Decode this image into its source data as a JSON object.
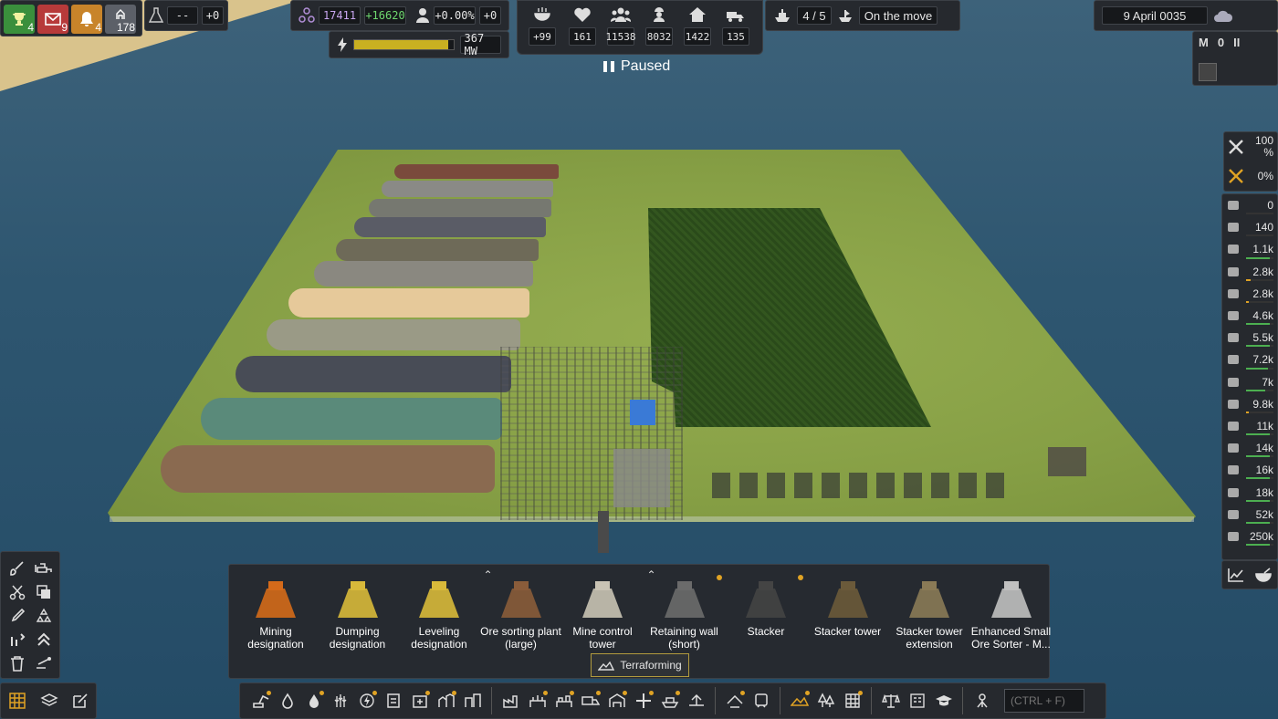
{
  "notifications": [
    {
      "icon": "trophy-icon",
      "count": "4",
      "color": "#3a8f3c"
    },
    {
      "icon": "mail-icon",
      "count": "9",
      "color": "#b73a3a"
    },
    {
      "icon": "bell-icon",
      "count": "4",
      "color": "#c8842a"
    },
    {
      "icon": "workers-icon",
      "count": "178",
      "color": "#5c6068"
    }
  ],
  "research": {
    "icon": "flask-icon",
    "value": "--",
    "delta": "+0"
  },
  "unity": {
    "value": "17411",
    "income": "+16620"
  },
  "population_growth": {
    "value": "+0.00%",
    "delta": "+0"
  },
  "power": {
    "value": "367 MW",
    "fill": 0.95
  },
  "pop_stats": [
    {
      "icon": "food-icon",
      "value": "+99"
    },
    {
      "icon": "health-icon",
      "value": "161"
    },
    {
      "icon": "population-icon",
      "value": "11538"
    },
    {
      "icon": "workers-icon",
      "value": "8032"
    },
    {
      "icon": "housing-icon",
      "value": "1422"
    },
    {
      "icon": "vehicles-icon",
      "value": "135"
    }
  ],
  "paused_label": "Paused",
  "ships": {
    "value": "4 / 5",
    "status": "On the move"
  },
  "date": "9 April 0035",
  "speed": {
    "m": "M",
    "o": "0",
    "pause": "II"
  },
  "maintenance": [
    {
      "icon": "tools-icon",
      "value": "100 %"
    },
    {
      "icon": "tools-warn-icon",
      "value": "0%"
    }
  ],
  "resources": [
    {
      "icon": "coal-icon",
      "value": "0",
      "fill": 0.0,
      "color": "#555"
    },
    {
      "icon": "flask-purple-icon",
      "value": "140",
      "fill": 0.0,
      "color": "#555"
    },
    {
      "icon": "food-crate-icon",
      "value": "1.1k",
      "fill": 0.85,
      "color": "#4caf50"
    },
    {
      "icon": "product-yellow-icon",
      "value": "2.8k",
      "fill": 0.15,
      "color": "#e0a324"
    },
    {
      "icon": "product-red-icon",
      "value": "2.8k",
      "fill": 0.1,
      "color": "#e0a324"
    },
    {
      "icon": "wood-icon",
      "value": "4.6k",
      "fill": 0.85,
      "color": "#4caf50"
    },
    {
      "icon": "plank-icon",
      "value": "5.5k",
      "fill": 0.85,
      "color": "#4caf50"
    },
    {
      "icon": "parts-icon",
      "value": "7.2k",
      "fill": 0.8,
      "color": "#4caf50"
    },
    {
      "icon": "shovel-icon",
      "value": "7k",
      "fill": 0.7,
      "color": "#4caf50"
    },
    {
      "icon": "steel-icon",
      "value": "9.8k",
      "fill": 0.1,
      "color": "#e0a324"
    },
    {
      "icon": "block-icon",
      "value": "11k",
      "fill": 0.85,
      "color": "#4caf50"
    },
    {
      "icon": "slab-icon",
      "value": "14k",
      "fill": 0.85,
      "color": "#4caf50"
    },
    {
      "icon": "barrel-icon",
      "value": "16k",
      "fill": 0.85,
      "color": "#4caf50"
    },
    {
      "icon": "fuel-icon",
      "value": "18k",
      "fill": 0.85,
      "color": "#4caf50"
    },
    {
      "icon": "sheet-icon",
      "value": "52k",
      "fill": 0.85,
      "color": "#4caf50"
    },
    {
      "icon": "rock-icon",
      "value": "250k",
      "fill": 0.85,
      "color": "#4caf50"
    }
  ],
  "build_items": [
    {
      "label": "Mining designation",
      "icon": "excavator-icon",
      "dot": false,
      "up": false
    },
    {
      "label": "Dumping designation",
      "icon": "dump-truck-icon",
      "dot": false,
      "up": false
    },
    {
      "label": "Leveling designation",
      "icon": "leveling-icon",
      "dot": false,
      "up": false
    },
    {
      "label": "Ore sorting plant (large)",
      "icon": "ore-sorting-icon",
      "dot": false,
      "up": true
    },
    {
      "label": "Mine control tower",
      "icon": "tower-icon",
      "dot": false,
      "up": false
    },
    {
      "label": "Retaining wall (short)",
      "icon": "wall-icon",
      "dot": true,
      "up": true
    },
    {
      "label": "Stacker",
      "icon": "stacker-icon",
      "dot": true,
      "up": false
    },
    {
      "label": "Stacker tower",
      "icon": "stacker-tower-icon",
      "dot": false,
      "up": false
    },
    {
      "label": "Stacker tower extension",
      "icon": "stacker-ext-icon",
      "dot": false,
      "up": false
    },
    {
      "label": "Enhanced Small Ore Sorter - M...",
      "icon": "ore-sorter-icon",
      "dot": false,
      "up": false
    }
  ],
  "category_tab": {
    "label": "Terraforming",
    "icon": "terraforming-icon"
  },
  "search": {
    "placeholder": "(CTRL + F)"
  }
}
